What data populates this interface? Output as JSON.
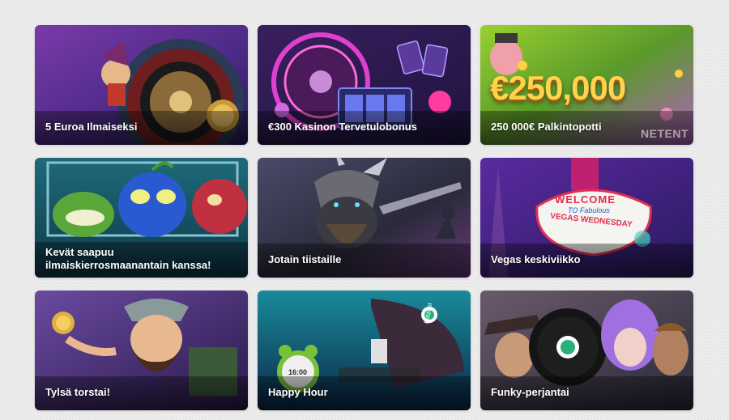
{
  "promotions": [
    {
      "title": "5 Euroa Ilmaiseksi",
      "art": "roulette-wheel-jester"
    },
    {
      "title": "€300 Kasinon Tervetulobonus",
      "art": "neon-roulette-777-slot"
    },
    {
      "title": "250 000€ Palkintopotti",
      "art": "pig-character-prize",
      "amount_text": "€250,000",
      "provider_logo_text": "NETENT"
    },
    {
      "title": "Kevät saapuu ilmaiskierrosmaanantain kanssa!",
      "art": "fruit-monsters"
    },
    {
      "title": "Jotain tiistaille",
      "art": "viking-warrior"
    },
    {
      "title": "Vegas keskiviikko",
      "art": "vegas-sign",
      "sign_text_top": "WELCOME",
      "sign_text_mid": "TO Fabulous",
      "sign_text_bottom": "VEGAS WEDNESDAY"
    },
    {
      "title": "Tylsä torstai!",
      "art": "gonzo-explorer"
    },
    {
      "title": "Happy Hour",
      "art": "viking-ship-alarm-clock",
      "clock_text": "16:00",
      "flag_text": "betzest"
    },
    {
      "title": "Funky-perjantai",
      "art": "vinyl-record-characters"
    }
  ]
}
